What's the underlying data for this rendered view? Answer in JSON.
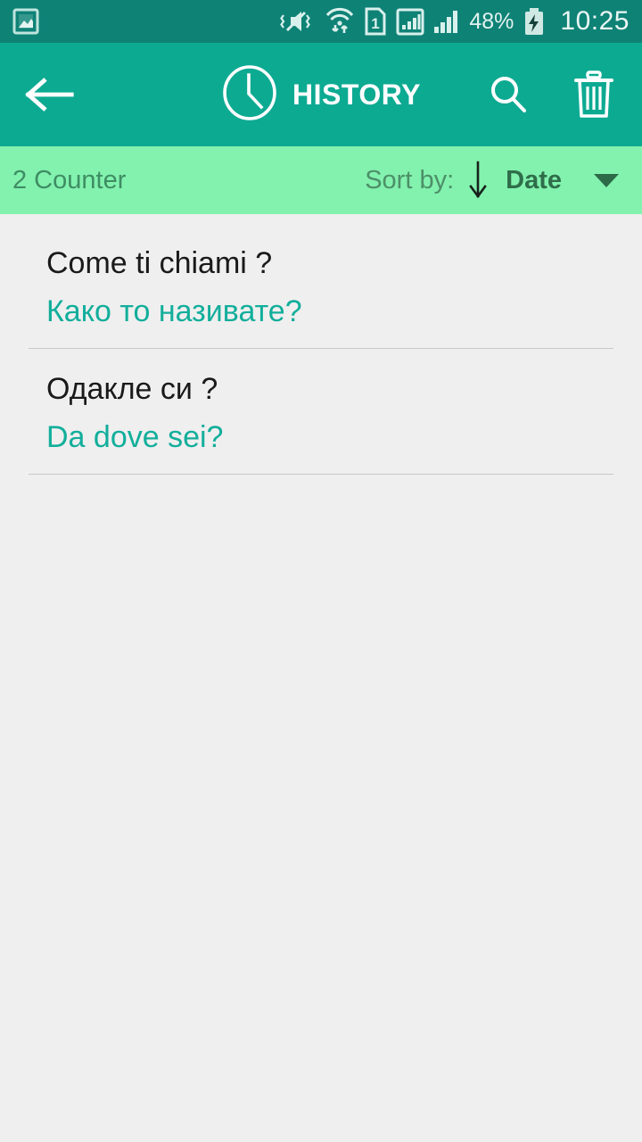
{
  "status_bar": {
    "icons": [
      "gallery-image-icon",
      "vibrate-mute-icon",
      "wifi-transfer-icon",
      "sim-1-icon",
      "signal-boxed-icon",
      "signal-bars-icon"
    ],
    "battery_percent": "48%",
    "battery_state": "charging",
    "time": "10:25",
    "background": "#0f8276"
  },
  "app_bar": {
    "back_label": "back-arrow",
    "title": "HISTORY",
    "clock_icon": "clock-icon",
    "search_label": "search",
    "delete_label": "delete-all",
    "background": "#0daa92",
    "foreground": "#ffffff"
  },
  "sort_bar": {
    "counter": "2 Counter",
    "sort_by_label": "Sort by:",
    "sort_direction": "descending",
    "sort_value": "Date",
    "background": "#82f2ae",
    "text_color": "#3f8d63"
  },
  "history": {
    "items": [
      {
        "source_text": "Come ti chiami ?",
        "target_text": "Како то називате?"
      },
      {
        "source_text": "Одакле си ?",
        "target_text": "Da dove sei?"
      }
    ],
    "source_color": "#1a1a1a",
    "target_color": "#12ae9b",
    "background": "#efefef"
  }
}
